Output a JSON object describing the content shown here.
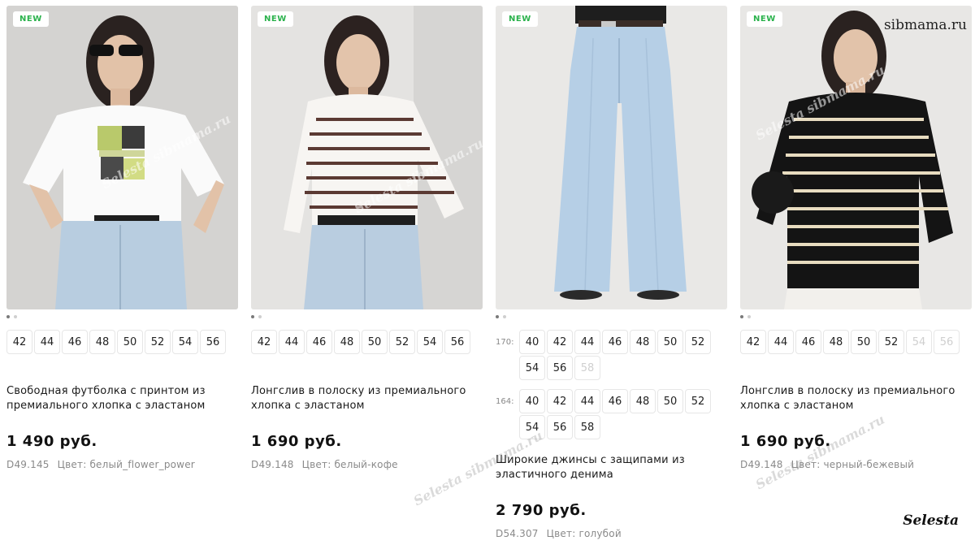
{
  "watermark": {
    "site": "sibmama.ru",
    "diagonal": "Selesta sibmama.ru",
    "corner": "Selesta"
  },
  "colors": {
    "badge_text": "#2bb24c",
    "price": "#111111",
    "meta": "#8a8a8a"
  },
  "products": [
    {
      "badge": "NEW",
      "image": "woman-white-tshirt-print",
      "sizes": [
        {
          "label": "42",
          "available": true
        },
        {
          "label": "44",
          "available": true
        },
        {
          "label": "46",
          "available": true
        },
        {
          "label": "48",
          "available": true
        },
        {
          "label": "50",
          "available": true
        },
        {
          "label": "52",
          "available": true
        },
        {
          "label": "54",
          "available": true
        },
        {
          "label": "56",
          "available": true
        }
      ],
      "title": "Свободная футболка с принтом из премиального хлопка с эластаном",
      "price": "1 490 руб.",
      "sku": "D49.145",
      "color": "Цвет: белый_flower_power"
    },
    {
      "badge": "NEW",
      "image": "woman-striped-longsleeve-white-coffee",
      "sizes": [
        {
          "label": "42",
          "available": true
        },
        {
          "label": "44",
          "available": true
        },
        {
          "label": "46",
          "available": true
        },
        {
          "label": "48",
          "available": true
        },
        {
          "label": "50",
          "available": true
        },
        {
          "label": "52",
          "available": true
        },
        {
          "label": "54",
          "available": true
        },
        {
          "label": "56",
          "available": true
        }
      ],
      "title": "Лонгслив в полоску из премиального хлопка с эластаном",
      "price": "1 690 руб.",
      "sku": "D49.148",
      "color": "Цвет: белый-кофе"
    },
    {
      "badge": "NEW",
      "image": "wide-leg-jeans-light-blue",
      "size_groups": [
        {
          "height": "170:",
          "sizes": [
            {
              "label": "40",
              "available": true
            },
            {
              "label": "42",
              "available": true
            },
            {
              "label": "44",
              "available": true
            },
            {
              "label": "46",
              "available": true
            },
            {
              "label": "48",
              "available": true
            },
            {
              "label": "50",
              "available": true
            },
            {
              "label": "52",
              "available": true
            },
            {
              "label": "54",
              "available": true
            },
            {
              "label": "56",
              "available": true
            },
            {
              "label": "58",
              "available": false
            }
          ]
        },
        {
          "height": "164:",
          "sizes": [
            {
              "label": "40",
              "available": true
            },
            {
              "label": "42",
              "available": true
            },
            {
              "label": "44",
              "available": true
            },
            {
              "label": "46",
              "available": true
            },
            {
              "label": "48",
              "available": true
            },
            {
              "label": "50",
              "available": true
            },
            {
              "label": "52",
              "available": true
            },
            {
              "label": "54",
              "available": true
            },
            {
              "label": "56",
              "available": true
            },
            {
              "label": "58",
              "available": true
            }
          ]
        }
      ],
      "title": "Широкие джинсы с защипами из эластичного денима",
      "price": "2 790 руб.",
      "sku": "D54.307",
      "color": "Цвет: голубой"
    },
    {
      "badge": "NEW",
      "image": "woman-striped-longsleeve-black-beige",
      "sizes": [
        {
          "label": "42",
          "available": true
        },
        {
          "label": "44",
          "available": true
        },
        {
          "label": "46",
          "available": true
        },
        {
          "label": "48",
          "available": true
        },
        {
          "label": "50",
          "available": true
        },
        {
          "label": "52",
          "available": true
        },
        {
          "label": "54",
          "available": false
        },
        {
          "label": "56",
          "available": false
        }
      ],
      "title": "Лонгслив в полоску из премиального хлопка с эластаном",
      "price": "1 690 руб.",
      "sku": "D49.148",
      "color": "Цвет: черный-бежевый"
    }
  ]
}
